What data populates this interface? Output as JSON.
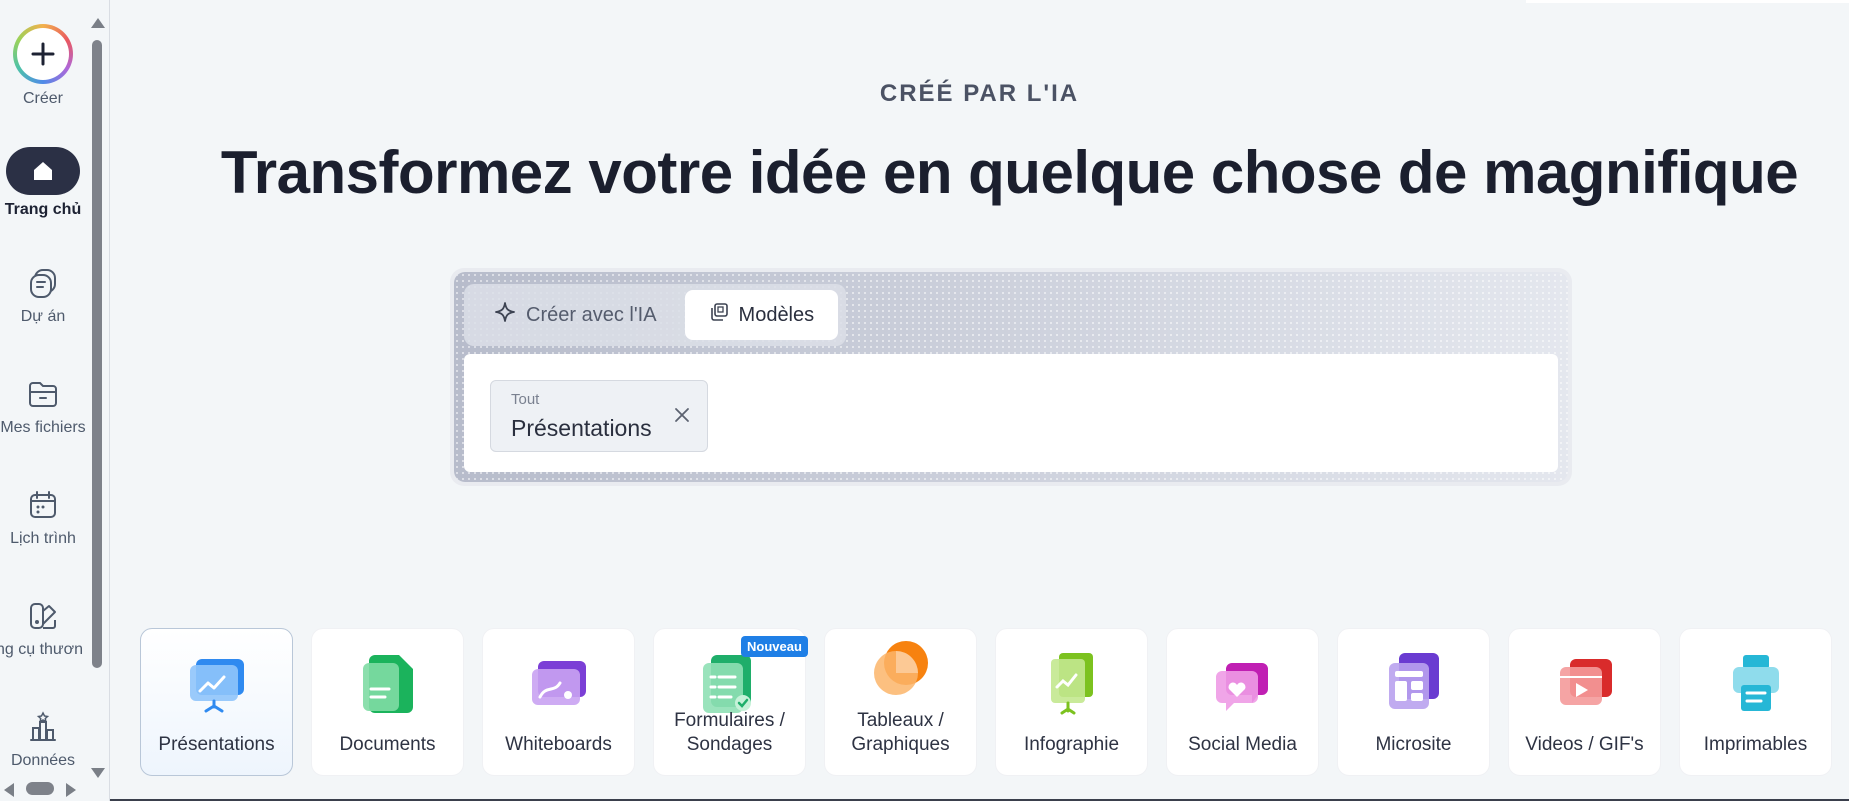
{
  "sidebar": {
    "items": [
      {
        "label": "Créer",
        "icon": "plus-icon"
      },
      {
        "label": "Trang chủ",
        "icon": "home-icon",
        "active": true
      },
      {
        "label": "Dự án",
        "icon": "projects-icon"
      },
      {
        "label": "Mes fichiers",
        "icon": "folder-icon"
      },
      {
        "label": "Lịch trình",
        "icon": "calendar-icon"
      },
      {
        "label": "ng cụ thươn",
        "icon": "brand-tools-icon"
      },
      {
        "label": "Données",
        "icon": "data-icon"
      }
    ]
  },
  "hero": {
    "eyebrow": "CRÉÉ PAR L'IA",
    "title": "Transformez votre idée en quelque chose de magnifique"
  },
  "panel": {
    "tabs": [
      {
        "label": "Créer avec l'IA",
        "icon": "sparkle-icon",
        "active": false
      },
      {
        "label": "Modèles",
        "icon": "templates-icon",
        "active": true
      }
    ],
    "chip": {
      "small": "Tout",
      "value": "Présentations"
    }
  },
  "categories": [
    {
      "label": "Présentations",
      "selected": true
    },
    {
      "label": "Documents"
    },
    {
      "label": "Whiteboards"
    },
    {
      "label": "Formulaires / Sondages",
      "badge": "Nouveau"
    },
    {
      "label": "Tableaux / Graphiques"
    },
    {
      "label": "Infographie"
    },
    {
      "label": "Social Media"
    },
    {
      "label": "Microsite"
    },
    {
      "label": "Videos / GIF's"
    },
    {
      "label": "Imprimables"
    }
  ],
  "colors": {
    "accent": "#1f7fe6",
    "dark": "#2b3045",
    "background": "#f3f6f8"
  }
}
